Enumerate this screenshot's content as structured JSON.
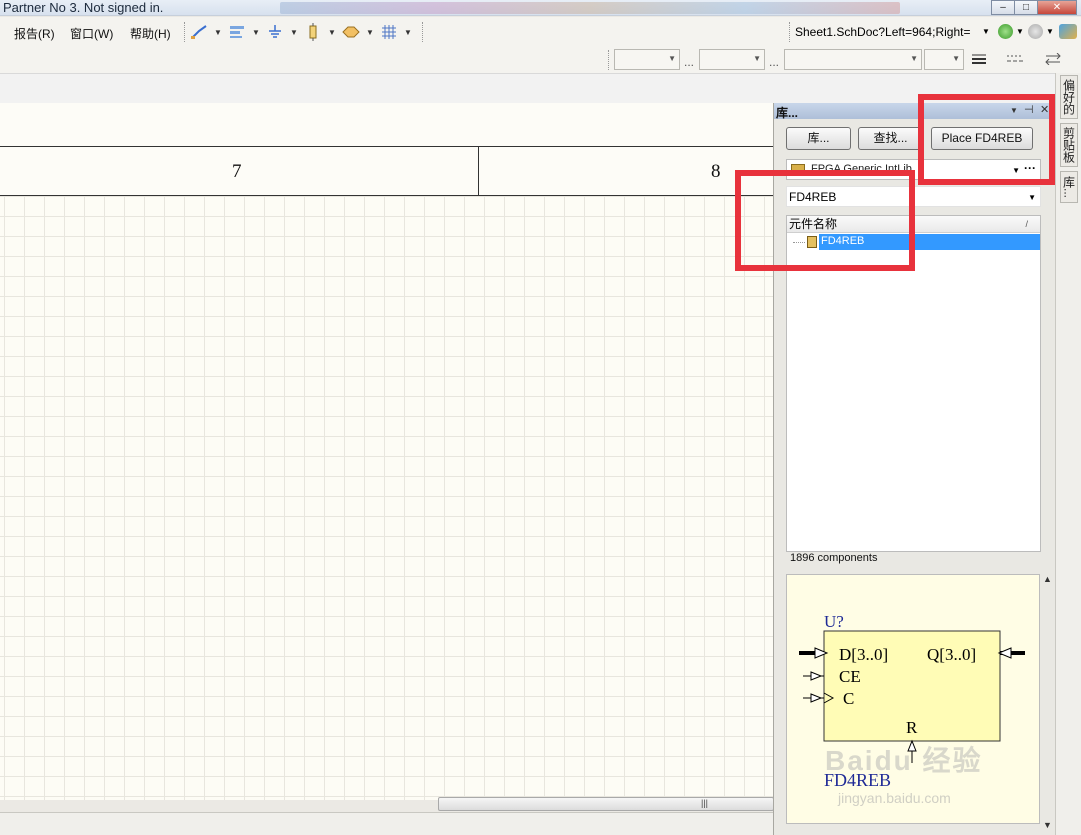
{
  "window": {
    "title": "Partner No 3. Not signed in.",
    "controls": {
      "minimize": "–",
      "maximize": "□",
      "close": "✕"
    }
  },
  "menu": [
    {
      "label": "报告(R)"
    },
    {
      "label": "窗口(W)"
    },
    {
      "label": "帮助(H)"
    }
  ],
  "address": {
    "value": "Sheet1.SchDoc?Left=964;Right="
  },
  "sheet": {
    "zones": [
      "7",
      "8"
    ]
  },
  "library_panel": {
    "title": "库...",
    "buttons": {
      "libraries": "库...",
      "search": "查找...",
      "place": "Place FD4REB"
    },
    "selected_library": "FPGA Generic.IntLib",
    "filter_value": "FD4REB",
    "column_header": "元件名称",
    "sort_mark": "/",
    "selected_component": "FD4REB",
    "component_count": "1896 components",
    "preview": {
      "designator": "U?",
      "pin_d": "D[3..0]",
      "pin_q": "Q[3..0]",
      "pin_ce": "CE",
      "pin_c": "C",
      "pin_r": "R",
      "part_name": "FD4REB",
      "fill_color": "#fffcb6",
      "text_color": "#1f2a96"
    }
  },
  "side_tabs": [
    "偏好的",
    "剪贴板",
    "库..."
  ],
  "watermark": {
    "text": "Baidu 经验",
    "url": "jingyan.baidu.com"
  },
  "colors": {
    "annotation_red": "#e8323c",
    "selection_blue": "#3399ff"
  }
}
